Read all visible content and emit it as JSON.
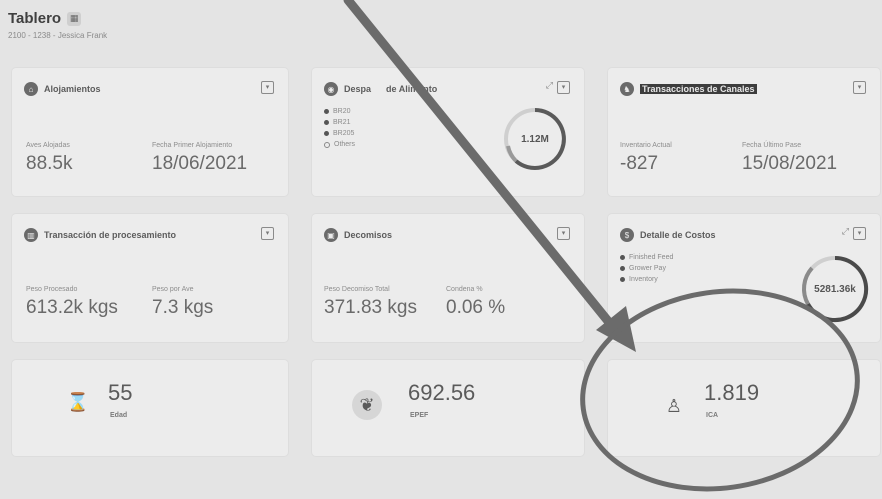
{
  "header": {
    "title": "Tablero",
    "subtitle": "2100 - 1238 - Jessica Frank"
  },
  "cards": {
    "alojamientos": {
      "title": "Alojamientos",
      "metric1_label": "Aves Alojadas",
      "metric1_value": "88.5k",
      "metric2_label": "Fecha Primer Alojamiento",
      "metric2_value": "18/06/2021"
    },
    "despacho": {
      "title_a": "Despa",
      "title_b": "de Alimento",
      "legend": [
        "BR20",
        "BR21",
        "BR205",
        "Others"
      ],
      "donut_value": "1.12M"
    },
    "transacciones": {
      "title": "Transacciones de Canales",
      "metric1_label": "Inventario Actual",
      "metric1_value": "-827",
      "metric2_label": "Fecha Último Pase",
      "metric2_value": "15/08/2021"
    },
    "procesamiento": {
      "title": "Transacción de procesamiento",
      "metric1_label": "Peso Procesado",
      "metric1_value": "613.2k kgs",
      "metric2_label": "Peso por Ave",
      "metric2_value": "7.3 kgs"
    },
    "decomisos": {
      "title": "Decomisos",
      "metric1_label": "Peso Decomiso Total",
      "metric1_value": "371.83 kgs",
      "metric2_label": "Condena %",
      "metric2_value": "0.06 %"
    },
    "costos": {
      "title": "Detalle de Costos",
      "legend": [
        "Finished Feed",
        "Grower Pay",
        "Inventory"
      ],
      "donut_value": "5281.36k"
    }
  },
  "kpis": [
    {
      "value": "55",
      "label": "Edad",
      "icon": "hourglass-icon"
    },
    {
      "value": "692.56",
      "label": "EPEF",
      "icon": "feather-icon"
    },
    {
      "value": "1.819",
      "label": "ICA",
      "icon": "chick-icon"
    }
  ],
  "colors": {
    "background": "#e4e4e4",
    "card": "#ececec",
    "annotation": "#6b6b6b"
  }
}
